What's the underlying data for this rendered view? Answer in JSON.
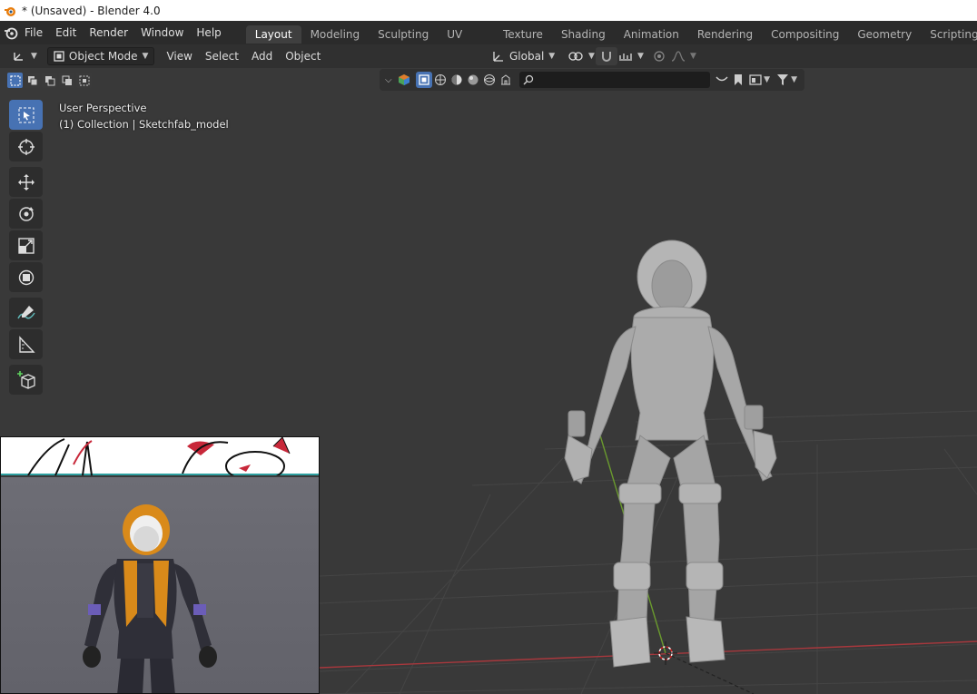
{
  "os_title": {
    "text": "* (Unsaved) - Blender 4.0",
    "logo_icon": "blender-logo-icon"
  },
  "menu": {
    "items": [
      "File",
      "Edit",
      "Render",
      "Window",
      "Help"
    ]
  },
  "workspaces": {
    "tabs": [
      "Layout",
      "Modeling",
      "Sculpting",
      "UV Editing",
      "Texture Paint",
      "Shading",
      "Animation",
      "Rendering",
      "Compositing",
      "Geometry Nodes",
      "Scripting"
    ],
    "active": "Layout"
  },
  "header": {
    "mode": "Object Mode",
    "view": "View",
    "select": "Select",
    "add": "Add",
    "object": "Object",
    "orientation": "Global"
  },
  "viewport": {
    "perspective": "User Perspective",
    "collection": "(1) Collection | Sketchfab_model"
  },
  "toolbar": {
    "tools": [
      "select-box",
      "cursor",
      "move",
      "rotate",
      "scale",
      "transform",
      "annotate",
      "measure",
      "add-cube"
    ],
    "active": "select-box"
  },
  "colors": {
    "accent": "#4772b3",
    "x_axis": "#a8383d",
    "y_axis": "#6a9a2e",
    "viewport_bg": "#393939",
    "topbar_bg": "#2b2b2b"
  }
}
